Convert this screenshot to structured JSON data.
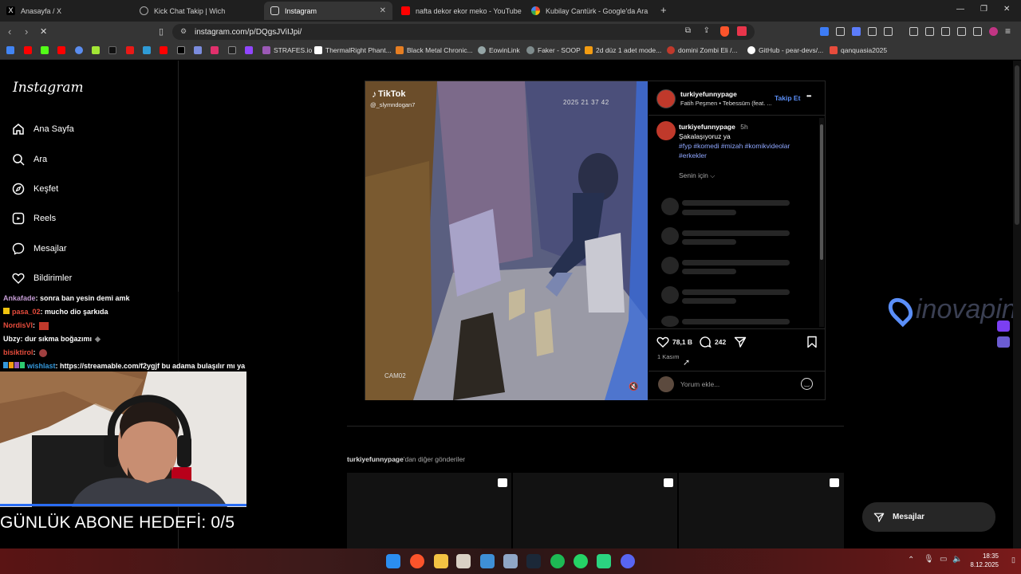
{
  "tabs": [
    {
      "label": "Anasayfa / X",
      "icon": "x-icon"
    },
    {
      "label": "Kick Chat Takip | Wich",
      "icon": "globe-icon"
    },
    {
      "label": "Instagram",
      "icon": "instagram-icon",
      "active": true
    },
    {
      "label": "nafta dekor ekor meko - YouTube",
      "icon": "youtube-icon"
    },
    {
      "label": "Kubilay Cantürk - Google'da Ara",
      "icon": "google-icon"
    }
  ],
  "new_tab": "+",
  "window_controls": {
    "minimize": "—",
    "restore": "❐",
    "close": "✕"
  },
  "address": {
    "url": "instagram.com/p/DQgsJViIJpi/"
  },
  "bookmarks": [
    {
      "label": "STRAFES.io",
      "color": "#9b59b6"
    },
    {
      "label": "ThermalRight Phant...",
      "color": "#ffffff"
    },
    {
      "label": "Black Metal Chronic...",
      "color": "#e67e22"
    },
    {
      "label": "EowinLink",
      "color": "#95a5a6"
    },
    {
      "label": "Faker - SOOP",
      "color": "#7f8c8d"
    },
    {
      "label": "2d düz 1 adet mode...",
      "color": "#f39c12"
    },
    {
      "label": "domini Zombi Eli /...",
      "color": "#c0392b"
    },
    {
      "label": "GitHub - pear-devs/...",
      "color": "#ffffff"
    },
    {
      "label": "qanquasia2025",
      "color": "#e74c3c"
    }
  ],
  "sidebar": {
    "logo": "Instagram",
    "items": [
      {
        "label": "Ana Sayfa",
        "icon": "home-icon"
      },
      {
        "label": "Ara",
        "icon": "search-icon"
      },
      {
        "label": "Keşfet",
        "icon": "compass-icon"
      },
      {
        "label": "Reels",
        "icon": "reels-icon"
      },
      {
        "label": "Mesajlar",
        "icon": "messenger-icon"
      },
      {
        "label": "Bildirimler",
        "icon": "heart-icon"
      }
    ]
  },
  "post": {
    "watermark": "TikTok",
    "watermark_handle": "@_slymndogan7",
    "timestamp": "2025 21 37 42",
    "cam_label": "CAM02",
    "author": "turkiyefunnypage",
    "audio": "Fatih Peşmen • Tebessüm (feat. ...",
    "follow": "Takip Et",
    "more": "•••",
    "caption_author": "turkiyefunnypage",
    "caption_age": "5h",
    "caption_text": "Şakalaşıyoruz ya",
    "hashtags_line1": "#fyp #komedi #mizah #komikvideolar",
    "hashtags_line2": "#erkekler",
    "sort": "Senin için",
    "likes": "78,1 B",
    "comments": "242",
    "date": "1 Kasım",
    "comment_placeholder": "Yorum ekle..."
  },
  "more_from": {
    "user": "turkiyefunnypage",
    "suffix": "'dan diğer gönderiler"
  },
  "messages_button": "Mesajlar",
  "chat": [
    {
      "user": "Ankafade",
      "text": ": sonra ban yesin demi amk",
      "color": "#c39bd3"
    },
    {
      "user": "pasa_02",
      "text": ": mucho dio şarkıda",
      "color": "#e74c3c"
    },
    {
      "user": "NordisVI",
      "text": ": ",
      "color": "#e74c3c"
    },
    {
      "user": "Ubzy",
      "text": ": dur sıkma boğazımı",
      "color": "#ffffff"
    },
    {
      "user": "bisiktirol",
      "text": ": ",
      "color": "#e74c3c"
    },
    {
      "user": "wishlast",
      "text": ": https://streamable.com/f2ygjf bu adama bulaşılır mı ya",
      "color": "#3498db"
    }
  ],
  "goal_text": "GÜNLÜK ABONE HEDEFİ: 0/5",
  "inovapin": "inovapin",
  "clock": {
    "time": "18:35",
    "date": "8.12.2025"
  },
  "accent": "#0095f6"
}
